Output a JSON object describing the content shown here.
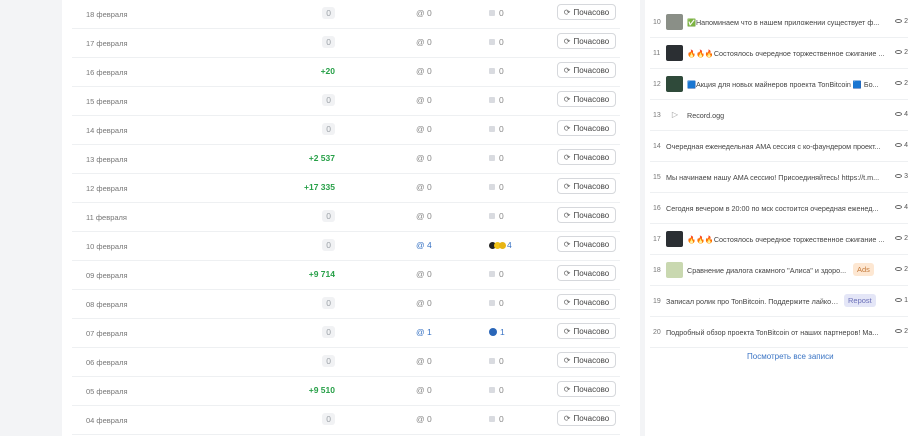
{
  "stats": {
    "button_label": "Почасово",
    "rows": [
      {
        "date": "18 февраля",
        "subs": "0",
        "subs_type": "zero",
        "mentions": "0",
        "mentions_active": false,
        "reposts": "0",
        "reposts_type": "none"
      },
      {
        "date": "17 февраля",
        "subs": "0",
        "subs_type": "zero",
        "mentions": "0",
        "mentions_active": false,
        "reposts": "0",
        "reposts_type": "none"
      },
      {
        "date": "16 февраля",
        "subs": "+20",
        "subs_type": "pos",
        "mentions": "0",
        "mentions_active": false,
        "reposts": "0",
        "reposts_type": "none"
      },
      {
        "date": "15 февраля",
        "subs": "0",
        "subs_type": "zero",
        "mentions": "0",
        "mentions_active": false,
        "reposts": "0",
        "reposts_type": "none"
      },
      {
        "date": "14 февраля",
        "subs": "0",
        "subs_type": "zero",
        "mentions": "0",
        "mentions_active": false,
        "reposts": "0",
        "reposts_type": "none"
      },
      {
        "date": "13 февраля",
        "subs": "+2 537",
        "subs_type": "pos",
        "mentions": "0",
        "mentions_active": false,
        "reposts": "0",
        "reposts_type": "none"
      },
      {
        "date": "12 февраля",
        "subs": "+17 335",
        "subs_type": "pos",
        "mentions": "0",
        "mentions_active": false,
        "reposts": "0",
        "reposts_type": "none"
      },
      {
        "date": "11 февраля",
        "subs": "0",
        "subs_type": "zero",
        "mentions": "0",
        "mentions_active": false,
        "reposts": "0",
        "reposts_type": "none"
      },
      {
        "date": "10 февраля",
        "subs": "0",
        "subs_type": "zero",
        "mentions": "4",
        "mentions_active": true,
        "reposts": "4",
        "reposts_type": "dots"
      },
      {
        "date": "09 февраля",
        "subs": "+9 714",
        "subs_type": "pos",
        "mentions": "0",
        "mentions_active": false,
        "reposts": "0",
        "reposts_type": "none"
      },
      {
        "date": "08 февраля",
        "subs": "0",
        "subs_type": "zero",
        "mentions": "0",
        "mentions_active": false,
        "reposts": "0",
        "reposts_type": "none"
      },
      {
        "date": "07 февраля",
        "subs": "0",
        "subs_type": "zero",
        "mentions": "1",
        "mentions_active": true,
        "reposts": "1",
        "reposts_type": "channel"
      },
      {
        "date": "06 февраля",
        "subs": "0",
        "subs_type": "zero",
        "mentions": "0",
        "mentions_active": false,
        "reposts": "0",
        "reposts_type": "none"
      },
      {
        "date": "05 февраля",
        "subs": "+9 510",
        "subs_type": "pos",
        "mentions": "0",
        "mentions_active": false,
        "reposts": "0",
        "reposts_type": "none"
      },
      {
        "date": "04 февраля",
        "subs": "0",
        "subs_type": "zero",
        "mentions": "0",
        "mentions_active": false,
        "reposts": "0",
        "reposts_type": "none"
      }
    ]
  },
  "posts": {
    "see_all": "Посмотреть все записи",
    "items": [
      {
        "num": "10",
        "thumb": "image",
        "thumb_color": "#8a8f87",
        "text": "✅Напоминаем что в нашем приложении существует ф...",
        "views": "2",
        "tag": ""
      },
      {
        "num": "11",
        "thumb": "image",
        "thumb_color": "#2b2f33",
        "text": "🔥🔥🔥Состоялось очередное торжественное сжигание ...",
        "views": "2",
        "tag": ""
      },
      {
        "num": "12",
        "thumb": "image",
        "thumb_color": "#2f4a3a",
        "text": "🟦Акция для новых майнеров проекта TonBitcoin 🟦 Бо...",
        "views": "2",
        "tag": ""
      },
      {
        "num": "13",
        "thumb": "audio",
        "thumb_color": "",
        "text": "Record.ogg",
        "views": "4",
        "tag": ""
      },
      {
        "num": "14",
        "thumb": "none",
        "thumb_color": "",
        "text": "Очередная еженедельная AMA сессия с ко-фаундером проект...",
        "views": "4",
        "tag": ""
      },
      {
        "num": "15",
        "thumb": "none",
        "thumb_color": "",
        "text": "Мы начинаем нашу AMA сессию! Присоединяйтесь! https://t.m...",
        "views": "3",
        "tag": ""
      },
      {
        "num": "16",
        "thumb": "none",
        "thumb_color": "",
        "text": "Сегодня вечером в 20:00 по мск состоится очередная еженед...",
        "views": "4",
        "tag": ""
      },
      {
        "num": "17",
        "thumb": "image",
        "thumb_color": "#2b2f33",
        "text": "🔥🔥🔥Состоялось очередное торжественное сжигание ...",
        "views": "2",
        "tag": ""
      },
      {
        "num": "18",
        "thumb": "image",
        "thumb_color": "#c9d8b0",
        "text": "Сравнение диалога скамного \"Алиса\" и здоро...",
        "views": "2",
        "tag": "Ads"
      },
      {
        "num": "19",
        "thumb": "none",
        "thumb_color": "",
        "text": "Записал ролик про TonBitcoin. Поддержите лайкос...",
        "views": "1",
        "tag": "Repost"
      },
      {
        "num": "20",
        "thumb": "none",
        "thumb_color": "",
        "text": "Подробный обзор проекта TonBitcoin от наших партнеров! Ма...",
        "views": "2",
        "tag": ""
      }
    ]
  },
  "colors": {
    "positive": "#27a048",
    "link": "#3a74c4",
    "ads_bg": "#fde7d2",
    "repost_bg": "#e4e6f7"
  }
}
